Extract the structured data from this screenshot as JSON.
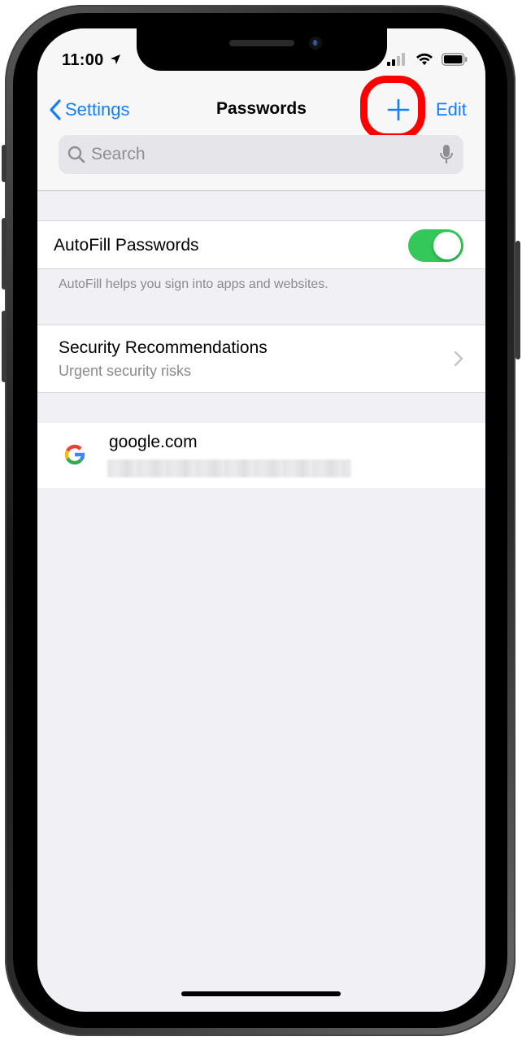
{
  "status_bar": {
    "time": "11:00",
    "location_icon": "location-arrow-icon",
    "signal_icon": "cellular-signal-icon",
    "wifi_icon": "wifi-icon",
    "battery_icon": "battery-icon"
  },
  "nav": {
    "back_label": "Settings",
    "back_icon": "chevron-left-icon",
    "title": "Passwords",
    "add_icon": "plus-icon",
    "edit_label": "Edit"
  },
  "search": {
    "placeholder": "Search",
    "icon": "search-icon",
    "mic_icon": "microphone-icon"
  },
  "autofill": {
    "label": "AutoFill Passwords",
    "enabled": true,
    "footnote": "AutoFill helps you sign into apps and websites."
  },
  "security": {
    "title": "Security Recommendations",
    "subtitle": "Urgent security risks"
  },
  "accounts": [
    {
      "site": "google.com",
      "icon": "google-logo-icon"
    }
  ],
  "colors": {
    "accent": "#157efb",
    "toggle_on": "#34c759",
    "highlight": "#ff0000",
    "background": "#f0f0f5"
  }
}
